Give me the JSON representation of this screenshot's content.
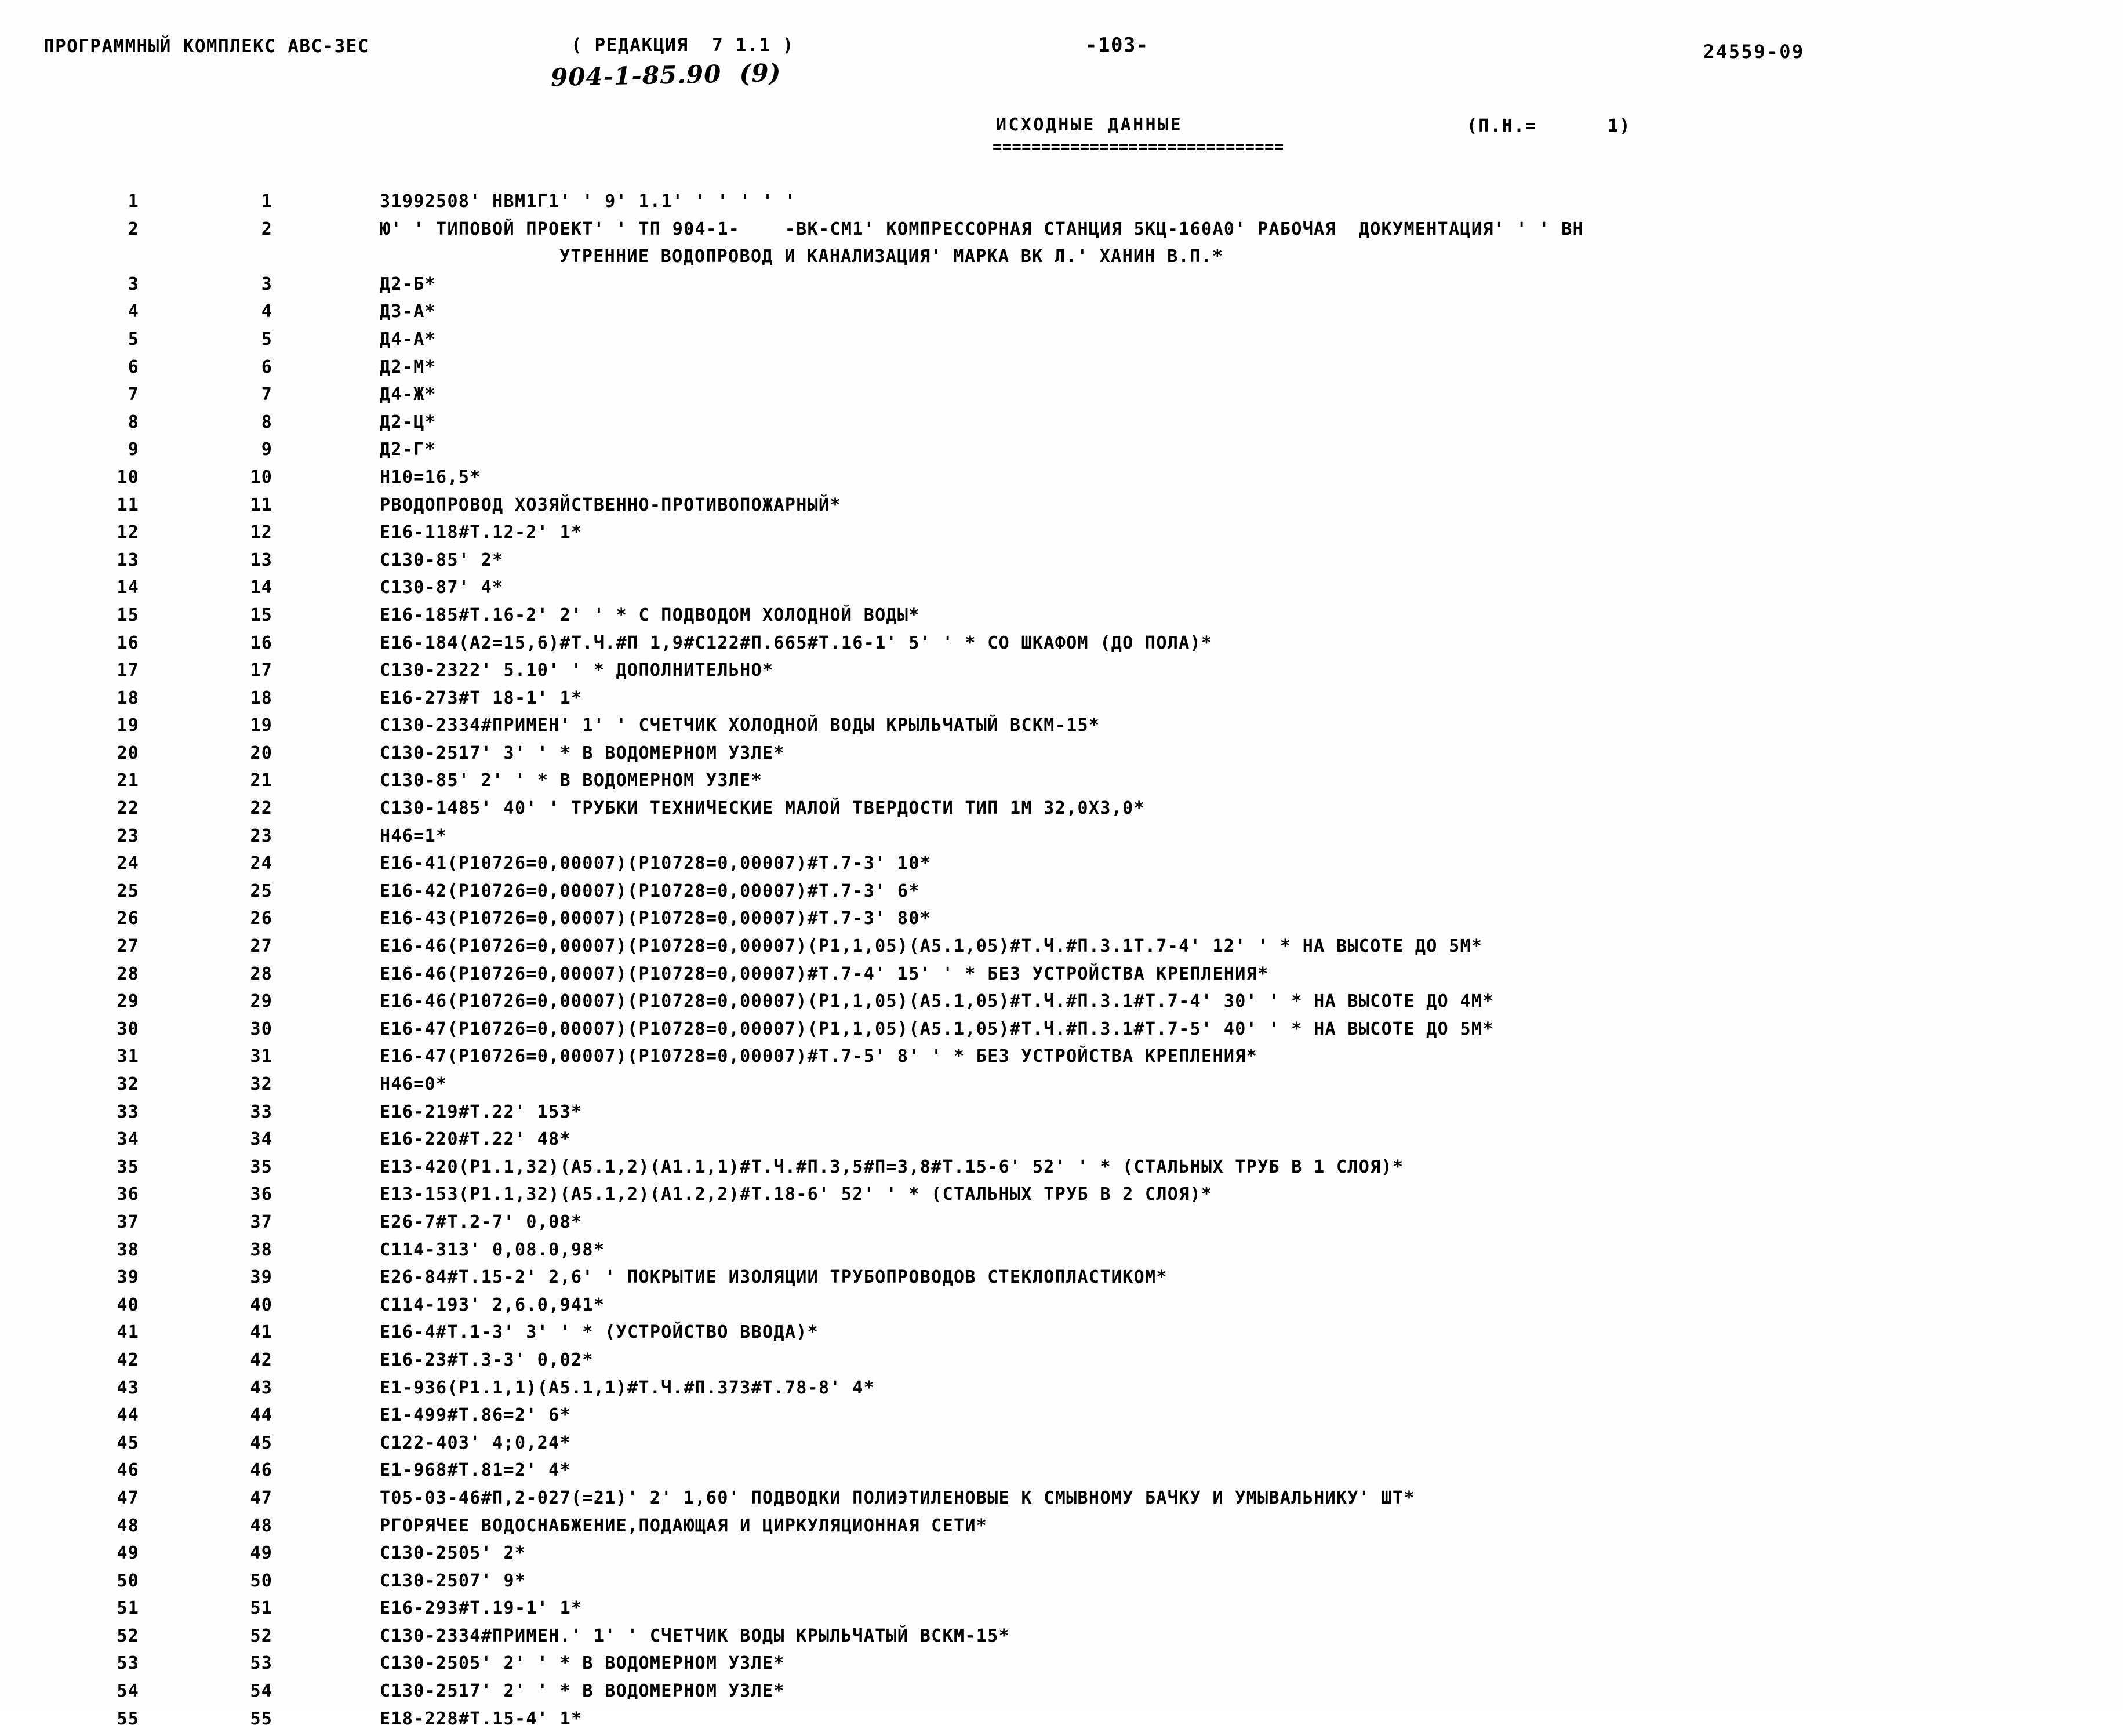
{
  "document": {
    "kind": "scanned-line-printer-listing",
    "header": {
      "program_complex": "ПРОГРАММНЫЙ КОМПЛЕКС АВС-ЗЕС",
      "edition": "( РЕДАКЦИЯ  7 1.1 )",
      "page_number": "-103-",
      "doc_number": "24559-09",
      "handwritten_note": "904-1-85.90  (9)",
      "subtitle": "ИСХОДНЫЕ ДАННЫЕ",
      "subtitle_rule": "==============================",
      "pn_marker": "(П.Н.=      1)"
    },
    "columns": {
      "seq_header": "",
      "line_header": "",
      "text_header": ""
    },
    "lines": [
      {
        "a": "1",
        "b": "1",
        "text": "31992508' НВМ1Г1' ' 9' 1.1' ' ' ' ' '"
      },
      {
        "a": "2",
        "b": "2",
        "text": "Ю' ' ТИПОВОЙ ПРОЕКТ' ' ТП 904-1-    -ВК-СМ1' КОМПРЕССОРНАЯ СТАНЦИЯ 5КЦ-160А0' РАБОЧАЯ  ДОКУМЕНТАЦИЯ' ' ' ВН"
      },
      {
        "a": "",
        "b": "",
        "cont": true,
        "text": "УТРЕННИЕ ВОДОПРОВОД И КАНАЛИЗАЦИЯ' МАРКА ВК Л.' ХАНИН В.П.*"
      },
      {
        "a": "3",
        "b": "3",
        "text": "Д2-Б*"
      },
      {
        "a": "4",
        "b": "4",
        "text": "Д3-А*"
      },
      {
        "a": "5",
        "b": "5",
        "text": "Д4-А*"
      },
      {
        "a": "6",
        "b": "6",
        "text": "Д2-М*"
      },
      {
        "a": "7",
        "b": "7",
        "text": "Д4-Ж*"
      },
      {
        "a": "8",
        "b": "8",
        "text": "Д2-Ц*"
      },
      {
        "a": "9",
        "b": "9",
        "text": "Д2-Г*"
      },
      {
        "a": "10",
        "b": "10",
        "text": "Н10=16,5*"
      },
      {
        "a": "11",
        "b": "11",
        "text": "РВОДОПРОВОД ХОЗЯЙСТВЕННО-ПРОТИВОПОЖАРНЫЙ*"
      },
      {
        "a": "12",
        "b": "12",
        "text": "Е16-118#Т.12-2' 1*"
      },
      {
        "a": "13",
        "b": "13",
        "text": "С130-85' 2*"
      },
      {
        "a": "14",
        "b": "14",
        "text": "С130-87' 4*"
      },
      {
        "a": "15",
        "b": "15",
        "text": "Е16-185#Т.16-2' 2' ' * С ПОДВОДОМ ХОЛОДНОЙ ВОДЫ*"
      },
      {
        "a": "16",
        "b": "16",
        "text": "Е16-184(А2=15,6)#Т.Ч.#П 1,9#С122#П.665#Т.16-1' 5' ' * СО ШКАФОМ (ДО ПОЛА)*"
      },
      {
        "a": "17",
        "b": "17",
        "text": "С130-2322' 5.10' ' * ДОПОЛНИТЕЛЬНО*"
      },
      {
        "a": "18",
        "b": "18",
        "text": "Е16-273#Т 18-1' 1*"
      },
      {
        "a": "19",
        "b": "19",
        "text": "С130-2334#ПРИМЕН' 1' ' СЧЕТЧИК ХОЛОДНОЙ ВОДЫ КРЫЛЬЧАТЫЙ ВСКМ-15*"
      },
      {
        "a": "20",
        "b": "20",
        "text": "С130-2517' 3' ' * В ВОДОМЕРНОМ УЗЛЕ*"
      },
      {
        "a": "21",
        "b": "21",
        "text": "С130-85' 2' ' * В ВОДОМЕРНОМ УЗЛЕ*"
      },
      {
        "a": "22",
        "b": "22",
        "text": "С130-1485' 40' ' ТРУБКИ ТЕХНИЧЕСКИЕ МАЛОЙ ТВЕРДОСТИ ТИП 1М 32,0Х3,0*"
      },
      {
        "a": "23",
        "b": "23",
        "text": "Н46=1*"
      },
      {
        "a": "24",
        "b": "24",
        "text": "Е16-41(Р10726=0,00007)(Р10728=0,00007)#Т.7-3' 10*"
      },
      {
        "a": "25",
        "b": "25",
        "text": "Е16-42(Р10726=0,00007)(Р10728=0,00007)#Т.7-3' 6*"
      },
      {
        "a": "26",
        "b": "26",
        "text": "Е16-43(Р10726=0,00007)(Р10728=0,00007)#Т.7-3' 80*"
      },
      {
        "a": "27",
        "b": "27",
        "text": "Е16-46(Р10726=0,00007)(Р10728=0,00007)(Р1,1,05)(А5.1,05)#Т.Ч.#П.3.1Т.7-4' 12' ' * НА ВЫСОТЕ ДО 5М*"
      },
      {
        "a": "28",
        "b": "28",
        "text": "Е16-46(Р10726=0,00007)(Р10728=0,00007)#Т.7-4' 15' ' * БЕЗ УСТРОЙСТВА КРЕПЛЕНИЯ*"
      },
      {
        "a": "29",
        "b": "29",
        "text": "Е16-46(Р10726=0,00007)(Р10728=0,00007)(Р1,1,05)(А5.1,05)#Т.Ч.#П.3.1#Т.7-4' 30' ' * НА ВЫСОТЕ ДО 4М*"
      },
      {
        "a": "30",
        "b": "30",
        "text": "Е16-47(Р10726=0,00007)(Р10728=0,00007)(Р1,1,05)(А5.1,05)#Т.Ч.#П.3.1#Т.7-5' 40' ' * НА ВЫСОТЕ ДО 5М*"
      },
      {
        "a": "31",
        "b": "31",
        "text": "Е16-47(Р10726=0,00007)(Р10728=0,00007)#Т.7-5' 8' ' * БЕЗ УСТРОЙСТВА КРЕПЛЕНИЯ*"
      },
      {
        "a": "32",
        "b": "32",
        "text": "Н46=0*"
      },
      {
        "a": "33",
        "b": "33",
        "text": "Е16-219#Т.22' 153*"
      },
      {
        "a": "34",
        "b": "34",
        "text": "Е16-220#Т.22' 48*"
      },
      {
        "a": "35",
        "b": "35",
        "text": "Е13-420(Р1.1,32)(А5.1,2)(А1.1,1)#Т.Ч.#П.3,5#П=3,8#Т.15-6' 52' ' * (СТАЛЬНЫХ ТРУБ В 1 СЛОЯ)*"
      },
      {
        "a": "36",
        "b": "36",
        "text": "Е13-153(Р1.1,32)(А5.1,2)(А1.2,2)#Т.18-6' 52' ' * (СТАЛЬНЫХ ТРУБ В 2 СЛОЯ)*"
      },
      {
        "a": "37",
        "b": "37",
        "text": "Е26-7#Т.2-7' 0,08*"
      },
      {
        "a": "38",
        "b": "38",
        "text": "С114-313' 0,08.0,98*"
      },
      {
        "a": "39",
        "b": "39",
        "text": "Е26-84#Т.15-2' 2,6' ' ПОКРЫТИЕ ИЗОЛЯЦИИ ТРУБОПРОВОДОВ СТЕКЛОПЛАСТИКОМ*"
      },
      {
        "a": "40",
        "b": "40",
        "text": "С114-193' 2,6.0,941*"
      },
      {
        "a": "41",
        "b": "41",
        "text": "Е16-4#Т.1-3' 3' ' * (УСТРОЙСТВО ВВОДА)*"
      },
      {
        "a": "42",
        "b": "42",
        "text": "Е16-23#Т.3-3' 0,02*"
      },
      {
        "a": "43",
        "b": "43",
        "text": "Е1-936(Р1.1,1)(А5.1,1)#Т.Ч.#П.373#Т.78-8' 4*"
      },
      {
        "a": "44",
        "b": "44",
        "text": "Е1-499#Т.86=2' 6*"
      },
      {
        "a": "45",
        "b": "45",
        "text": "С122-403' 4;0,24*"
      },
      {
        "a": "46",
        "b": "46",
        "text": "Е1-968#Т.81=2' 4*"
      },
      {
        "a": "47",
        "b": "47",
        "text": "Т05-03-46#П,2-027(=21)' 2' 1,60' ПОДВОДКИ ПОЛИЭТИЛЕНОВЫЕ К СМЫВНОМУ БАЧКУ И УМЫВАЛЬНИКУ' ШТ*"
      },
      {
        "a": "48",
        "b": "48",
        "text": "РГОРЯЧЕЕ ВОДОСНАБЖЕНИЕ,ПОДАЮЩАЯ И ЦИРКУЛЯЦИОННАЯ СЕТИ*"
      },
      {
        "a": "49",
        "b": "49",
        "text": "С130-2505' 2*"
      },
      {
        "a": "50",
        "b": "50",
        "text": "С130-2507' 9*"
      },
      {
        "a": "51",
        "b": "51",
        "text": "Е16-293#Т.19-1' 1*"
      },
      {
        "a": "52",
        "b": "52",
        "text": "С130-2334#ПРИМЕН.' 1' ' СЧЕТЧИК ВОДЫ КРЫЛЬЧАТЫЙ ВСКМ-15*"
      },
      {
        "a": "53",
        "b": "53",
        "text": "С130-2505' 2' ' * В ВОДОМЕРНОМ УЗЛЕ*"
      },
      {
        "a": "54",
        "b": "54",
        "text": "С130-2517' 2' ' * В ВОДОМЕРНОМ УЗЛЕ*"
      },
      {
        "a": "55",
        "b": "55",
        "text": "Е18-228#Т.15-4' 1*"
      }
    ]
  }
}
